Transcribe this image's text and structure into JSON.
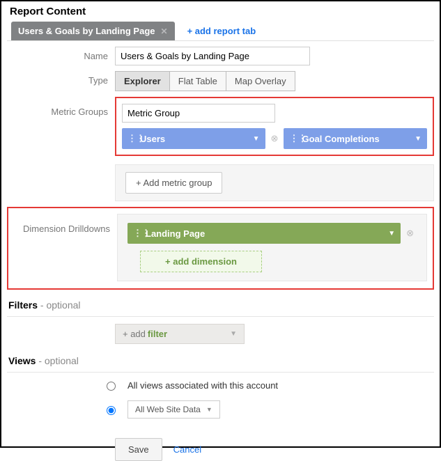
{
  "title": "Report Content",
  "tab": {
    "label": "Users & Goals by Landing Page"
  },
  "addTab": "+ add report tab",
  "labels": {
    "name": "Name",
    "type": "Type",
    "metricGroups": "Metric Groups",
    "dimensionDrilldowns": "Dimension Drilldowns"
  },
  "nameValue": "Users & Goals by Landing Page",
  "typeOptions": {
    "explorer": "Explorer",
    "flatTable": "Flat Table",
    "mapOverlay": "Map Overlay"
  },
  "metricGroup": {
    "nameValue": "Metric Group",
    "chips": {
      "users": "Users",
      "goalCompletions": "Goal Completions"
    },
    "addButton": "+ Add metric group"
  },
  "dimension": {
    "chip": "Landing Page",
    "addButton": "+ add dimension"
  },
  "filters": {
    "heading": "Filters",
    "optional": " - optional",
    "addPrefix": "+ add ",
    "addWord": "filter"
  },
  "views": {
    "heading": "Views",
    "optional": " - optional",
    "allViews": "All views associated with this account",
    "selected": "All Web Site Data"
  },
  "buttons": {
    "save": "Save",
    "cancel": "Cancel"
  }
}
